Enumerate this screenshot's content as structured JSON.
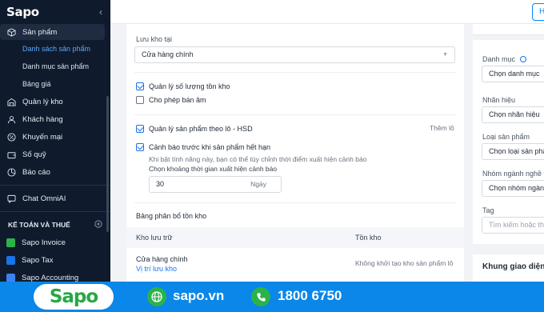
{
  "sidebar": {
    "brand": "Sapo",
    "collapse_icon": "‹",
    "products": "Sản phẩm",
    "sub_items": [
      "Danh sách sản phẩm",
      "Danh mục sản phẩm",
      "Bảng giá"
    ],
    "items": [
      "Quản lý kho",
      "Khách hàng",
      "Khuyến mại",
      "Sổ quỹ",
      "Báo cáo"
    ],
    "chat": "Chat OmniAI",
    "section_title": "KẾ TOÁN VÀ THUẾ",
    "apps": [
      "Sapo Invoice",
      "Sapo Tax",
      "Sapo Accounting"
    ]
  },
  "topbar": {
    "button_label": "H"
  },
  "form": {
    "store_label": "Lưu kho tại",
    "store_value": "Cửa hàng chính",
    "manage_stock": "Quản lý số lượng tồn kho",
    "allow_negative": "Cho phép bán âm",
    "manage_lot": "Quản lý sản phẩm theo lô - HSD",
    "add_more": "Thêm lô",
    "expiry_warning": "Cảnh báo trước khi sản phẩm hết hạn",
    "hint1": "Khi bật tính năng này, bạn có thể tùy chỉnh thời điểm xuất hiện cảnh báo",
    "hint2": "Chọn khoảng thời gian xuất hiện cảnh báo",
    "days_value": "30",
    "days_unit": "Ngày",
    "distribution_title": "Bảng phân bổ tồn kho",
    "col_location": "Kho lưu trữ",
    "col_stock": "Tồn kho",
    "row_store": "Cửa hàng chính",
    "row_link": "Vị trí lưu kho",
    "row_status": "Không khởi tạo kho sản phẩm lô"
  },
  "right_panel": {
    "category_label": "Danh mục",
    "category_value": "Chọn danh mục",
    "brand_label": "Nhãn hiệu",
    "brand_value": "Chọn nhãn hiệu",
    "type_label": "Loại sản phẩm",
    "type_value": "Chọn loại sản phẩ",
    "industry_label": "Nhóm ngành nghề t",
    "industry_value": "Chọn nhóm ngành",
    "tag_label": "Tag",
    "tag_placeholder": "Tìm kiếm hoặc th",
    "frame_title": "Khung giao diện"
  },
  "banner": {
    "logo": "Sapo",
    "website": "sapo.vn",
    "hotline": "1800 6750"
  }
}
